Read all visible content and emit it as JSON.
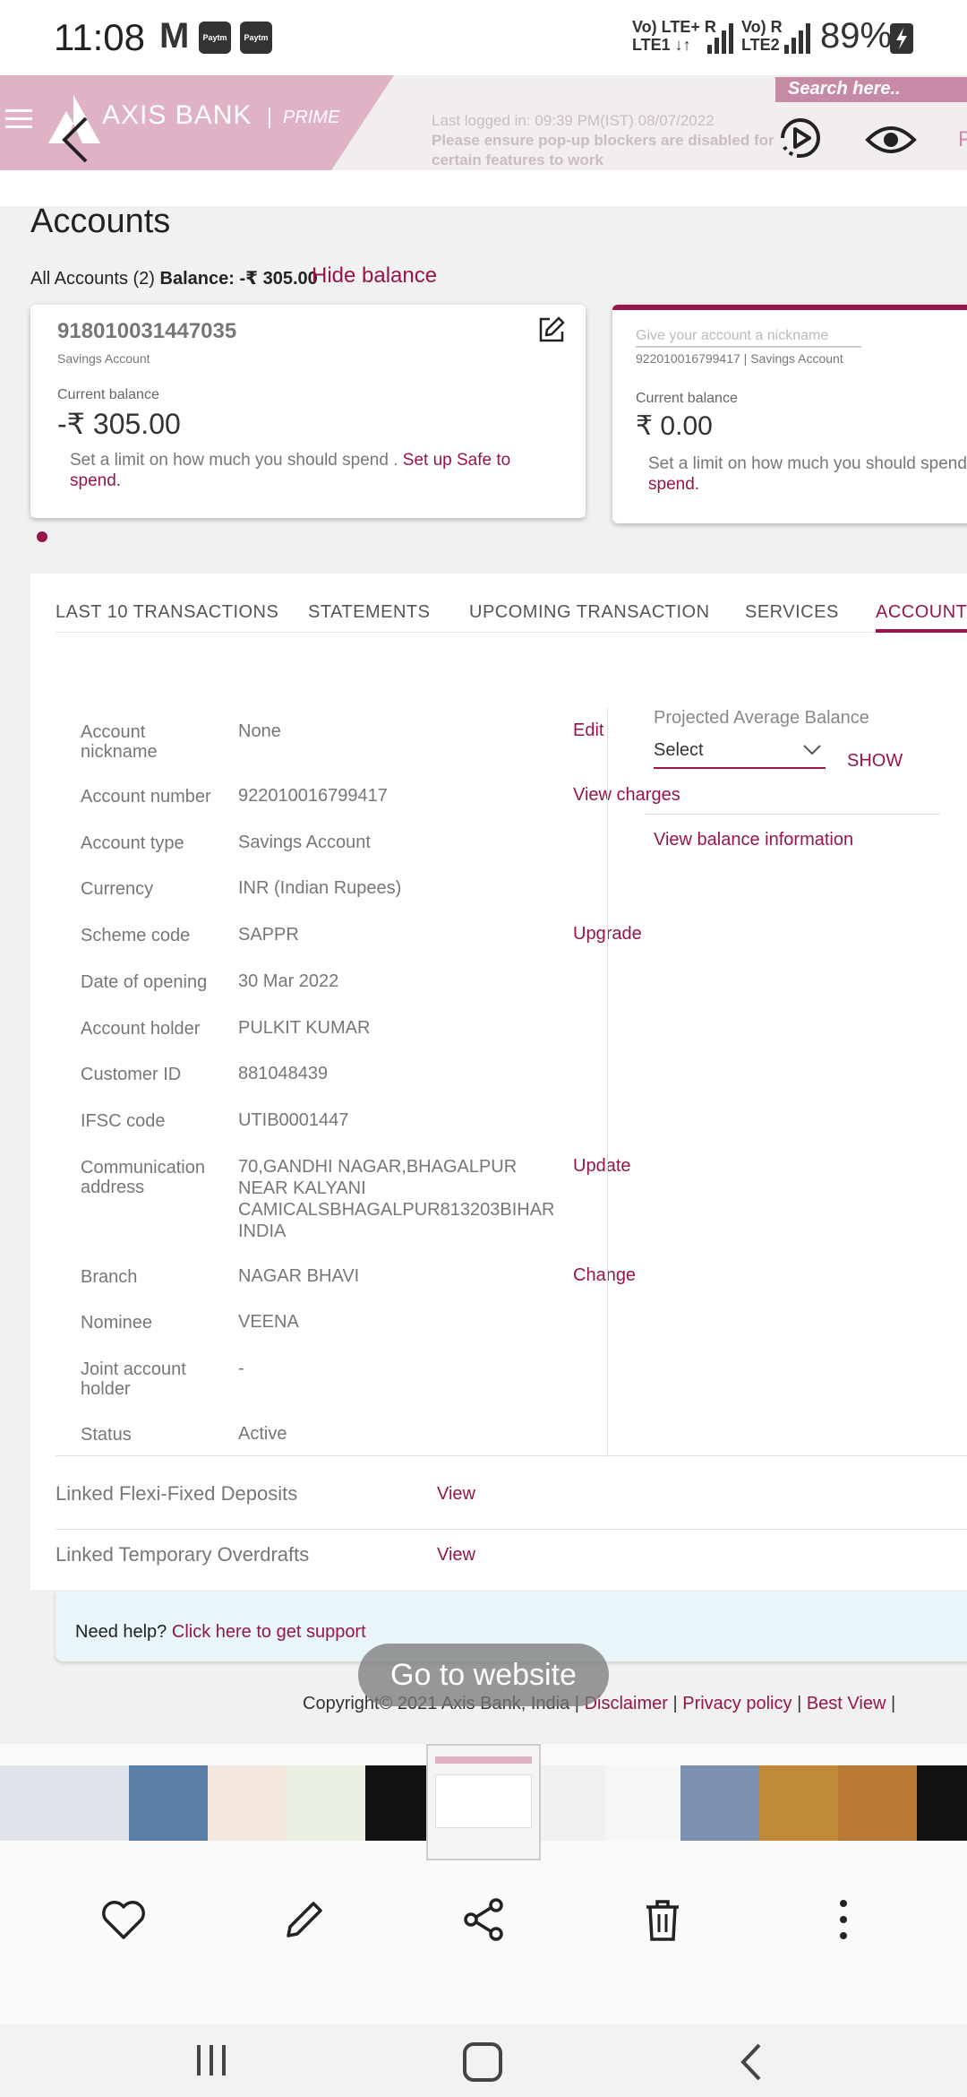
{
  "status_bar": {
    "time": "11:08",
    "mail_icon": "M",
    "notif_label": "Paytm",
    "network1_top": "Vo) LTE+ R",
    "network1_bottom": "LTE1 ↓↑",
    "network2_top": "Vo) R",
    "network2_bottom": "LTE2",
    "battery": "89%"
  },
  "header": {
    "brand": "AXIS BANK",
    "tier": "PRIME",
    "search_placeholder": "Search here..",
    "last_login": "Last logged in: 09:39 PM(IST) 08/07/2022",
    "popup_notice": "Please ensure pop-up blockers are disabled for certain features to work",
    "trailing_letter": "P"
  },
  "accounts": {
    "title": "Accounts",
    "summary_prefix": "All Accounts (2)",
    "summary_balance": "Balance: -₹ 305.00",
    "hide_balance": "Hide balance",
    "cards": [
      {
        "number": "918010031447035",
        "type": "Savings Account",
        "balance_label": "Current balance",
        "balance": "-₹ 305.00",
        "limit_text": "Set a limit on how much you should spend .",
        "limit_link": "Set up Safe to spend."
      },
      {
        "nickname_placeholder": "Give your account a nickname",
        "subline": "922010016799417 | Savings Account",
        "balance_label": "Current balance",
        "balance": "₹ 0.00",
        "limit_text": "Set a limit on how much you should spend",
        "limit_link": "spend."
      }
    ]
  },
  "tabs": [
    {
      "label": "LAST 10 TRANSACTIONS"
    },
    {
      "label": "STATEMENTS"
    },
    {
      "label": "UPCOMING TRANSACTION"
    },
    {
      "label": "SERVICES"
    },
    {
      "label": "ACCOUNT I"
    }
  ],
  "details": {
    "rows": [
      {
        "label": "Account nickname",
        "value": "None",
        "action": "Edit"
      },
      {
        "label": "Account number",
        "value": "922010016799417",
        "action": "View charges"
      },
      {
        "label": "Account type",
        "value": "Savings Account",
        "action": ""
      },
      {
        "label": "Currency",
        "value": "INR (Indian Rupees)",
        "action": ""
      },
      {
        "label": "Scheme code",
        "value": "SAPPR",
        "action": "Upgrade"
      },
      {
        "label": "Date of opening",
        "value": "30 Mar 2022",
        "action": ""
      },
      {
        "label": "Account holder",
        "value": "PULKIT KUMAR",
        "action": ""
      },
      {
        "label": "Customer ID",
        "value": "881048439",
        "action": ""
      },
      {
        "label": "IFSC code",
        "value": "UTIB0001447",
        "action": ""
      },
      {
        "label": "Communication address",
        "value": "70,GANDHI NAGAR,BHAGALPUR NEAR KALYANI CAMICALSBHAGALPUR813203BIHAR INDIA",
        "action": "Update"
      },
      {
        "label": "Branch",
        "value": "NAGAR BHAVI",
        "action": "Change"
      },
      {
        "label": "Nominee",
        "value": "VEENA",
        "action": ""
      },
      {
        "label": "Joint account holder",
        "value": "-",
        "action": ""
      },
      {
        "label": "Status",
        "value": "Active",
        "action": ""
      }
    ],
    "projected_label": "Projected Average Balance",
    "select_value": "Select",
    "show": "SHOW",
    "view_balance_info": "View balance information"
  },
  "linked": [
    {
      "label": "Linked Flexi-Fixed Deposits",
      "action": "View"
    },
    {
      "label": "Linked Temporary Overdrafts",
      "action": "View"
    }
  ],
  "help": {
    "prefix": "Need help?",
    "link": "Click here to get support"
  },
  "overlay": {
    "go_to_website": "Go to website"
  },
  "footer": {
    "copyright": "Copyright© 2021 Axis Bank, India |",
    "disclaimer": "Disclaimer",
    "privacy": "Privacy policy",
    "best_view": "Best View",
    "sep": "|"
  },
  "colors": {
    "brand": "#97144d",
    "header_pink": "#e0b2c6"
  }
}
